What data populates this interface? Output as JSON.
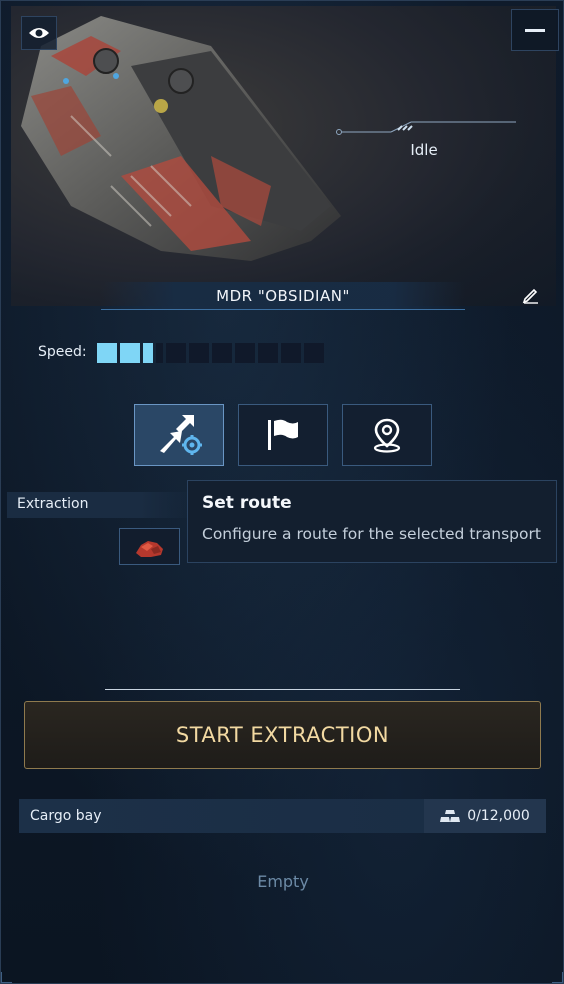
{
  "ship": {
    "name": "MDR \"OBSIDIAN\"",
    "status": "Idle",
    "speed_label": "Speed:",
    "speed_level": 2.5,
    "speed_max": 10
  },
  "actions": [
    {
      "name": "set-route",
      "icon": "route-gear-icon",
      "active": true
    },
    {
      "name": "flag",
      "icon": "flag-icon",
      "active": false
    },
    {
      "name": "location",
      "icon": "map-pin-icon",
      "active": false
    }
  ],
  "tooltip": {
    "title": "Set route",
    "description": "Configure a route for the selected transport"
  },
  "extraction": {
    "label": "Extraction",
    "resource_icon": "ore-icon"
  },
  "start_button": "START EXTRACTION",
  "cargo": {
    "label": "Cargo bay",
    "capacity": "0/12,000",
    "empty_text": "Empty"
  },
  "colors": {
    "speed_fill": "#7fd6f6",
    "start_text": "#f2d9a2",
    "start_border": "#8f7a4e"
  }
}
